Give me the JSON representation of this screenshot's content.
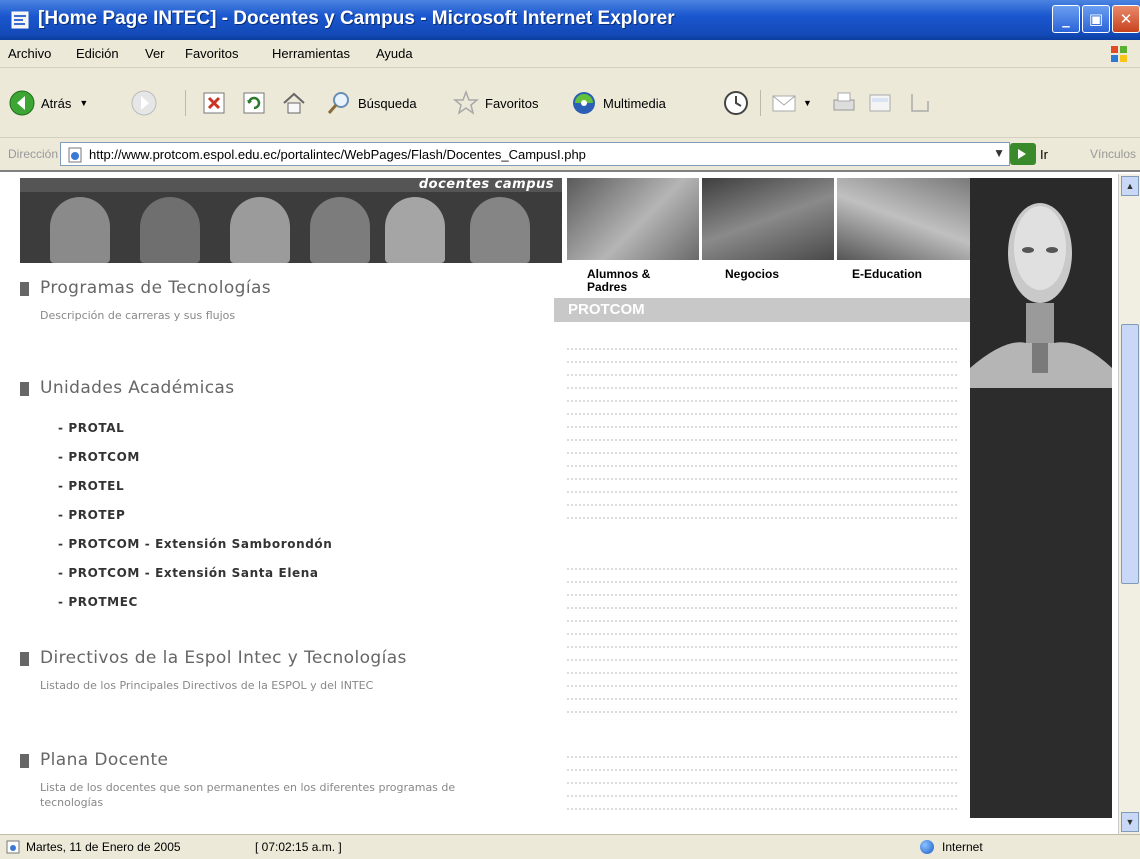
{
  "window": {
    "title": "[Home Page INTEC] - Docentes y Campus - Microsoft Internet Explorer"
  },
  "menu": [
    "Archivo",
    "Edición",
    "Ver",
    "Favoritos",
    "Herramientas",
    "Ayuda"
  ],
  "toolbar": {
    "back": "Atrás",
    "search": "Búsqueda",
    "favorites": "Favoritos",
    "media": "Multimedia"
  },
  "address": {
    "label": "Dirección",
    "url": "http://www.protcom.espol.edu.ec/portalintec/WebPages/Flash/Docentes_CampusI.php",
    "go": "Ir",
    "links": "Vínculos"
  },
  "banner": {
    "title": "docentes campus"
  },
  "sections": {
    "programas": {
      "title": "Programas de Tecnologías",
      "desc": "Descripción de carreras y sus flujos"
    },
    "unidades": {
      "title": "Unidades Académicas",
      "items": [
        "- PROTAL",
        "- PROTCOM",
        "- PROTEL",
        "- PROTEP",
        "- PROTCOM - Extensión Samborondón",
        "- PROTCOM - Extensión Santa Elena",
        "- PROTMEC"
      ]
    },
    "directivos": {
      "title": "Directivos de la Espol Intec y Tecnologías",
      "desc": "Listado de los Principales Directivos de la ESPOL y del INTEC"
    },
    "plana": {
      "title": "Plana Docente",
      "desc": "Lista de los docentes que son permanentes en los diferentes programas de tecnologías"
    }
  },
  "categories": {
    "alumnos": "Alumnos & Padres",
    "negocios": "Negocios",
    "eeducation": "E-Education"
  },
  "protcom_header": "PROTCOM",
  "status": {
    "date": "Martes, 11 de Enero de 2005",
    "time": "[ 07:02:15 a.m. ]",
    "zone": "Internet"
  }
}
